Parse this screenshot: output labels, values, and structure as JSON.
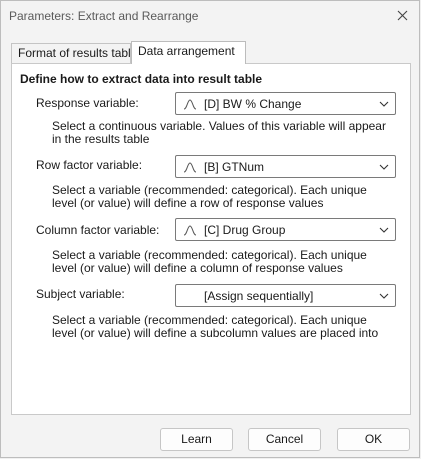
{
  "window": {
    "title": "Parameters: Extract and Rearrange"
  },
  "tabs": [
    {
      "label": "Format of results table",
      "active": false
    },
    {
      "label": "Data arrangement",
      "active": true
    }
  ],
  "panel": {
    "heading": "Define how to extract data into result table",
    "fields": [
      {
        "label": "Response variable:",
        "value": "[D] BW % Change",
        "icon": "distribution-icon",
        "help": "Select a continuous variable. Values of this variable will appear in the results table"
      },
      {
        "label": "Row factor variable:",
        "value": "[B] GTNum",
        "icon": "distribution-icon",
        "help": "Select a variable (recommended: categorical). Each unique level (or value) will define a row of response values"
      },
      {
        "label": "Column factor variable:",
        "value": "[C] Drug Group",
        "icon": "distribution-icon",
        "help": "Select a variable (recommended: categorical). Each unique level (or value) will define a column of response values"
      },
      {
        "label": "Subject variable:",
        "value": "[Assign sequentially]",
        "icon": "",
        "help": "Select a variable (recommended: categorical). Each unique level (or value) will define a subcolumn values are placed into"
      }
    ]
  },
  "buttons": {
    "learn": "Learn",
    "cancel": "Cancel",
    "ok": "OK"
  }
}
